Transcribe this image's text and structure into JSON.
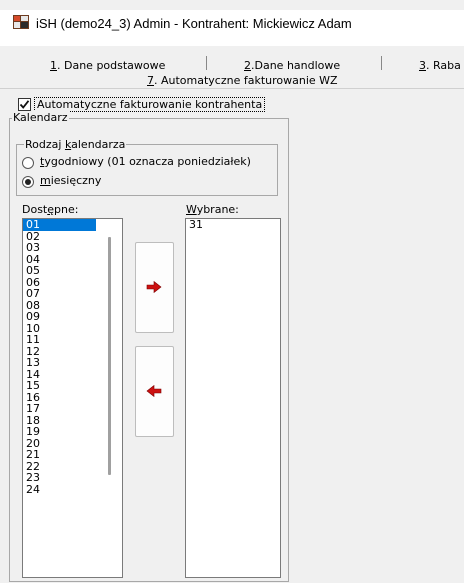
{
  "window": {
    "title": "iSH (demo24_3) Admin - Kontrahent: Mickiewicz Adam",
    "icon": "app-grid-icon"
  },
  "tabs": [
    {
      "key": "1",
      "rest": ". Dane podstawowe"
    },
    {
      "key": "2",
      "rest": ".Dane handlowe"
    },
    {
      "key": "3",
      "rest": ". Raba"
    },
    {
      "key": "7",
      "rest": ". Automatyczne fakturowanie WZ",
      "active": true
    }
  ],
  "auto_invoice": {
    "checked": true,
    "label": "Automatyczne fakturowanie kontrahenta"
  },
  "calendar": {
    "title": "Kalendarz",
    "type_group": {
      "title_pre": "Rodzaj ",
      "title_key": "k",
      "title_post": "alendarza",
      "options": [
        {
          "pre": "",
          "key": "t",
          "post": "ygodniowy (01 oznacza poniedziałek)",
          "selected": false
        },
        {
          "pre": "",
          "key": "m",
          "post": "iesięczny",
          "selected": true
        }
      ]
    }
  },
  "available": {
    "label_pre": "Dost",
    "label_key": "ę",
    "label_post": "pne:",
    "items": [
      "01",
      "02",
      "03",
      "04",
      "05",
      "06",
      "07",
      "08",
      "09",
      "10",
      "11",
      "12",
      "13",
      "14",
      "15",
      "16",
      "17",
      "18",
      "19",
      "20",
      "21",
      "22",
      "23",
      "24"
    ],
    "selected_index": 0
  },
  "selected": {
    "label_pre": "",
    "label_key": "W",
    "label_post": "ybrane:",
    "items": [
      "31"
    ]
  },
  "buttons": {
    "add_icon": "arrow-right-icon",
    "remove_icon": "arrow-left-icon",
    "arrow_color": "#cc1111"
  }
}
